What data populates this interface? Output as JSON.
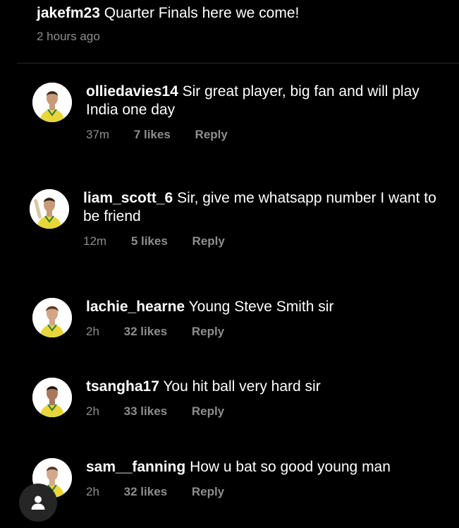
{
  "top_comment": {
    "username": "jakefm23",
    "text": "Quarter Finals here we come!",
    "time": "2 hours ago"
  },
  "comments": [
    {
      "username": "olliedavies14",
      "text": "Sir great player, big fan and will play India one day",
      "time": "37m",
      "likes": "7 likes",
      "reply_label": "Reply"
    },
    {
      "username": "liam_scott_6",
      "text": "Sir, give me whatsapp number I want to be friend",
      "time": "12m",
      "likes": "5 likes",
      "reply_label": "Reply"
    },
    {
      "username": "lachie_hearne",
      "text": "Young Steve Smith sir",
      "time": "2h",
      "likes": "32 likes",
      "reply_label": "Reply"
    },
    {
      "username": "tsangha17",
      "text": "You hit ball very hard sir",
      "time": "2h",
      "likes": "33 likes",
      "reply_label": "Reply"
    },
    {
      "username": "sam__fanning",
      "text": "How u bat so good young man",
      "time": "2h",
      "likes": "32 likes",
      "reply_label": "Reply"
    }
  ],
  "colors": {
    "background": "#000000",
    "text": "#ffffff",
    "muted": "#8e8e8e",
    "jersey": "#e8d63a",
    "jersey_trim": "#2f7a3c"
  },
  "icons": {
    "avatar": "player-avatar",
    "account_button": "person-icon"
  }
}
